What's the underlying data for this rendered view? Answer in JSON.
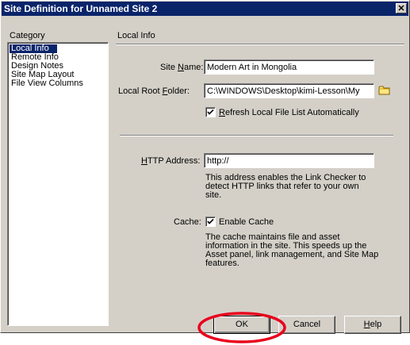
{
  "window": {
    "title": "Site Definition for Unnamed Site 2",
    "close_glyph": "✕"
  },
  "category": {
    "header": "Category",
    "items": [
      "Local Info",
      "Remote Info",
      "Design Notes",
      "Site Map Layout",
      "File View Columns"
    ],
    "selected": "Local Info"
  },
  "panel": {
    "title": "Local Info",
    "site_name": {
      "label_pre": "Site ",
      "label_key": "N",
      "label_post": "ame:",
      "value": "Modern Art in Mongolia"
    },
    "local_root": {
      "label_pre": "Local Root ",
      "label_key": "F",
      "label_post": "older:",
      "value": "C:\\WINDOWS\\Desktop\\kimi-Lesson\\My",
      "icon": "folder-icon"
    },
    "refresh": {
      "label_key": "R",
      "label_post": "efresh Local File List Automatically",
      "checked": true
    },
    "http": {
      "label_key": "H",
      "label_post": "TTP Address:",
      "value": "http://",
      "desc": [
        "This address enables the Link Checker to",
        "detect HTTP links that refer to your own",
        "site."
      ]
    },
    "cache": {
      "label": "Cache:",
      "checkbox_label": "Enable Cache",
      "checked": true,
      "desc": [
        "The cache maintains file and asset",
        "information in the site.  This speeds up the",
        "Asset panel, link management, and Site Map",
        "features."
      ]
    }
  },
  "buttons": {
    "ok": "OK",
    "cancel": "Cancel",
    "help_key": "H",
    "help_post": "elp"
  },
  "annotation": {
    "color": "#e8001c"
  }
}
